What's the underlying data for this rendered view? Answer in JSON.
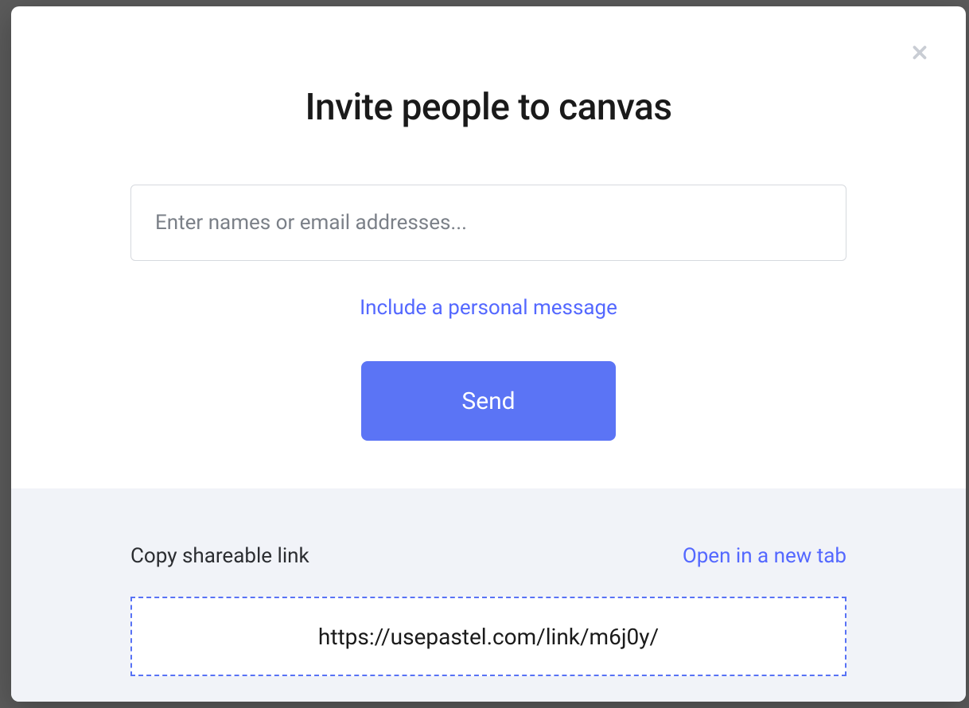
{
  "modal": {
    "title": "Invite people to canvas",
    "emailPlaceholder": "Enter names or email addresses...",
    "emailValue": "",
    "personalMessageLink": "Include a personal message",
    "sendButton": "Send"
  },
  "shareSection": {
    "copyLabel": "Copy shareable link",
    "openTabLink": "Open in a new tab",
    "shareUrl": "https://usepastel.com/link/m6j0y/"
  },
  "icons": {
    "close": "close-icon"
  },
  "colors": {
    "primary": "#5b74f5",
    "linkBlue": "#5468ff",
    "lowerBg": "#f1f3f8",
    "textDark": "#1a1a1a",
    "placeholder": "#7b8088",
    "closeGray": "#c9cdd4"
  }
}
